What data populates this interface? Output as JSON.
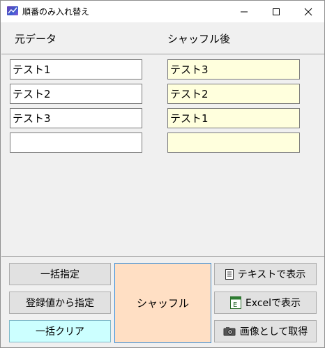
{
  "window": {
    "title": "順番のみ入れ替え",
    "minimize_glyph": "—",
    "maximize_glyph": "☐",
    "close_glyph": "✕"
  },
  "headers": {
    "original": "元データ",
    "shuffled": "シャッフル後"
  },
  "original_items": [
    "テスト1",
    "テスト2",
    "テスト3",
    ""
  ],
  "shuffled_items": [
    "テスト3",
    "テスト2",
    "テスト1",
    ""
  ],
  "buttons": {
    "bulk_specify": "一括指定",
    "specify_from_registered": "登録値から指定",
    "bulk_clear": "一括クリア",
    "shuffle": "シャッフル",
    "show_as_text": "テキストで表示",
    "show_in_excel": "Excelで表示",
    "save_as_image": "画像として取得"
  },
  "icons": {
    "app": "app-icon",
    "text": "text-document-icon",
    "excel": "excel-icon",
    "camera": "camera-icon"
  },
  "colors": {
    "shuffled_field_bg": "#ffffdd",
    "shuffle_button_bg": "#ffdfc4",
    "clear_button_bg": "#ccffff"
  }
}
